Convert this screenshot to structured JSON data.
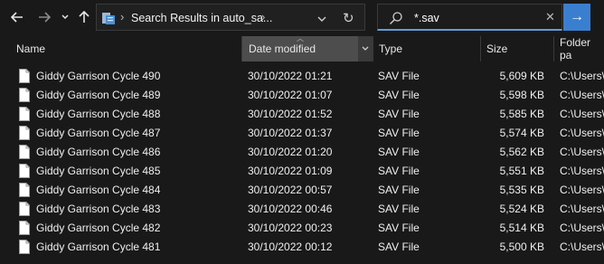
{
  "toolbar": {
    "address_text": "Search Results in auto_sa...",
    "search_value": "*.sav"
  },
  "columns": {
    "name": "Name",
    "date": "Date modified",
    "type": "Type",
    "size": "Size",
    "path": "Folder pa"
  },
  "rows": [
    {
      "name": "Giddy Garrison Cycle 490",
      "date": "30/10/2022 01:21",
      "type": "SAV File",
      "size": "5,609 KB",
      "path": "C:\\Users\\"
    },
    {
      "name": "Giddy Garrison Cycle 489",
      "date": "30/10/2022 01:07",
      "type": "SAV File",
      "size": "5,598 KB",
      "path": "C:\\Users\\"
    },
    {
      "name": "Giddy Garrison Cycle 488",
      "date": "30/10/2022 01:52",
      "type": "SAV File",
      "size": "5,585 KB",
      "path": "C:\\Users\\"
    },
    {
      "name": "Giddy Garrison Cycle 487",
      "date": "30/10/2022 01:37",
      "type": "SAV File",
      "size": "5,574 KB",
      "path": "C:\\Users\\"
    },
    {
      "name": "Giddy Garrison Cycle 486",
      "date": "30/10/2022 01:20",
      "type": "SAV File",
      "size": "5,562 KB",
      "path": "C:\\Users\\"
    },
    {
      "name": "Giddy Garrison Cycle 485",
      "date": "30/10/2022 01:09",
      "type": "SAV File",
      "size": "5,551 KB",
      "path": "C:\\Users\\"
    },
    {
      "name": "Giddy Garrison Cycle 484",
      "date": "30/10/2022 00:57",
      "type": "SAV File",
      "size": "5,535 KB",
      "path": "C:\\Users\\"
    },
    {
      "name": "Giddy Garrison Cycle 483",
      "date": "30/10/2022 00:46",
      "type": "SAV File",
      "size": "5,524 KB",
      "path": "C:\\Users\\"
    },
    {
      "name": "Giddy Garrison Cycle 482",
      "date": "30/10/2022 00:23",
      "type": "SAV File",
      "size": "5,514 KB",
      "path": "C:\\Users\\"
    },
    {
      "name": "Giddy Garrison Cycle 481",
      "date": "30/10/2022 00:12",
      "type": "SAV File",
      "size": "5,500 KB",
      "path": "C:\\Users\\"
    }
  ],
  "colors": {
    "background": "#191919",
    "sorted_header": "#4d4d4d",
    "accent": "#3a7fcf"
  }
}
